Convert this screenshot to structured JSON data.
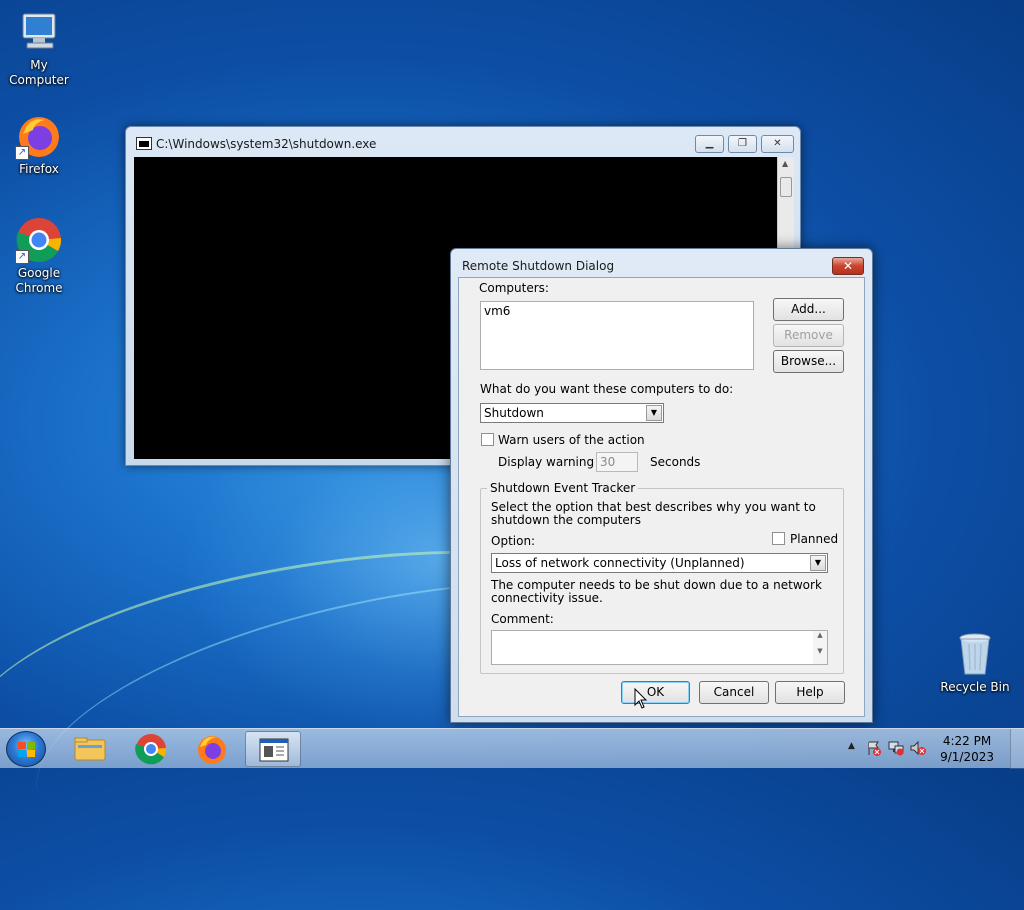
{
  "desktop": {
    "icons": [
      {
        "label": "My Computer"
      },
      {
        "label": "Firefox"
      },
      {
        "label": "Google Chrome"
      },
      {
        "label": "Recycle Bin"
      }
    ]
  },
  "console_window": {
    "title": "C:\\Windows\\system32\\shutdown.exe"
  },
  "dialog": {
    "title": "Remote Shutdown Dialog",
    "close_label": "✕",
    "computers_label": "Computers:",
    "computers": [
      "vm6"
    ],
    "add_label": "Add...",
    "remove_label": "Remove",
    "browse_label": "Browse...",
    "action_question": "What do you want these computers to do:",
    "action_value": "Shutdown",
    "warn_label": "Warn users of the action",
    "display_warning_label": "Display warning for",
    "warning_seconds": "30",
    "seconds_label": "Seconds",
    "tracker": {
      "legend": "Shutdown Event Tracker",
      "description": "Select the option that best describes why you want to shutdown the computers",
      "planned_label": "Planned",
      "option_label": "Option:",
      "option_value": "Loss of network connectivity (Unplanned)",
      "option_description": "The computer needs to be shut down due to a network connectivity issue.",
      "comment_label": "Comment:",
      "comment_value": ""
    },
    "ok_label": "OK",
    "cancel_label": "Cancel",
    "help_label": "Help"
  },
  "taskbar": {
    "time": "4:22 PM",
    "date": "9/1/2023"
  }
}
